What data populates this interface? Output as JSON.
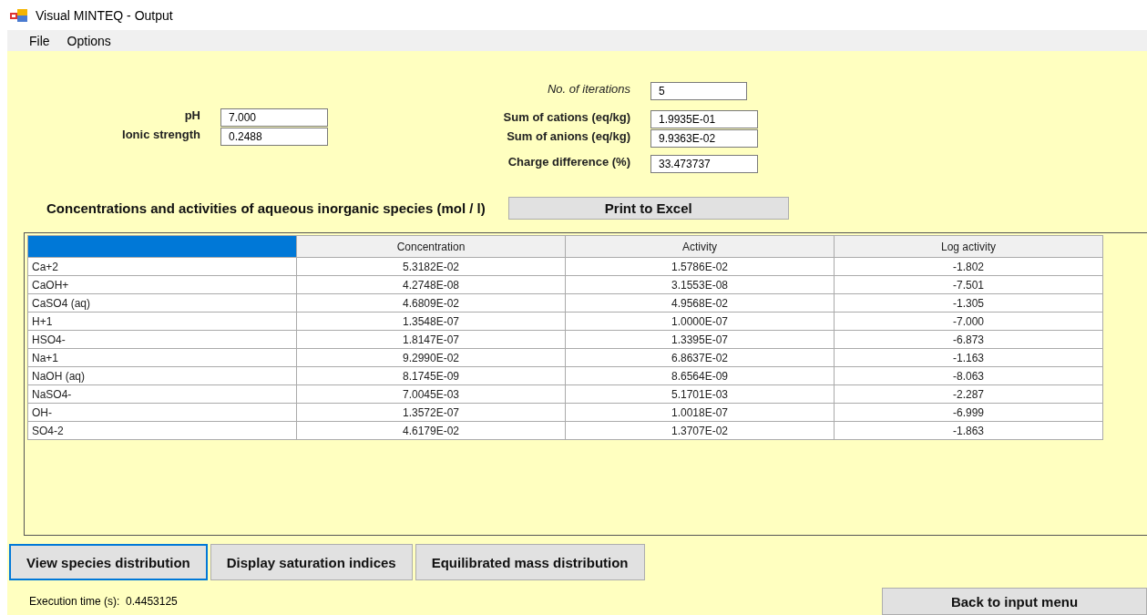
{
  "window": {
    "title": "Visual MINTEQ - Output"
  },
  "menu": [
    "File",
    "Options"
  ],
  "left_fields": [
    {
      "label": "pH",
      "value": "7.000"
    },
    {
      "label": "Ionic strength",
      "value": "0.2488"
    }
  ],
  "iterations": {
    "label": "No. of iterations",
    "value": "5"
  },
  "sums": [
    {
      "label": "Sum of cations (eq/kg)",
      "value": "1.9935E-01"
    },
    {
      "label": "Sum of anions (eq/kg)",
      "value": "9.9363E-02"
    }
  ],
  "charge": {
    "label": "Charge difference (%)",
    "value": "33.473737"
  },
  "section_title": "Concentrations and activities of aqueous inorganic species (mol / l)",
  "print_button": "Print to Excel",
  "table": {
    "columns": [
      "",
      "Concentration",
      "Activity",
      "Log activity"
    ],
    "rows": [
      [
        "Ca+2",
        "5.3182E-02",
        "1.5786E-02",
        "-1.802"
      ],
      [
        "CaOH+",
        "4.2748E-08",
        "3.1553E-08",
        "-7.501"
      ],
      [
        "CaSO4 (aq)",
        "4.6809E-02",
        "4.9568E-02",
        "-1.305"
      ],
      [
        "H+1",
        "1.3548E-07",
        "1.0000E-07",
        "-7.000"
      ],
      [
        "HSO4-",
        "1.8147E-07",
        "1.3395E-07",
        "-6.873"
      ],
      [
        "Na+1",
        "9.2990E-02",
        "6.8637E-02",
        "-1.163"
      ],
      [
        "NaOH (aq)",
        "8.1745E-09",
        "8.6564E-09",
        "-8.063"
      ],
      [
        "NaSO4-",
        "7.0045E-03",
        "5.1701E-03",
        "-2.287"
      ],
      [
        "OH-",
        "1.3572E-07",
        "1.0018E-07",
        "-6.999"
      ],
      [
        "SO4-2",
        "4.6179E-02",
        "1.3707E-02",
        "-1.863"
      ]
    ]
  },
  "tabs": [
    {
      "label": "View species distribution",
      "selected": true
    },
    {
      "label": "Display saturation indices",
      "selected": false
    },
    {
      "label": "Equilibrated mass distribution",
      "selected": false
    }
  ],
  "execution": {
    "label": "Execution time (s):",
    "value": "0.4453125"
  },
  "back_button": "Back to input menu"
}
